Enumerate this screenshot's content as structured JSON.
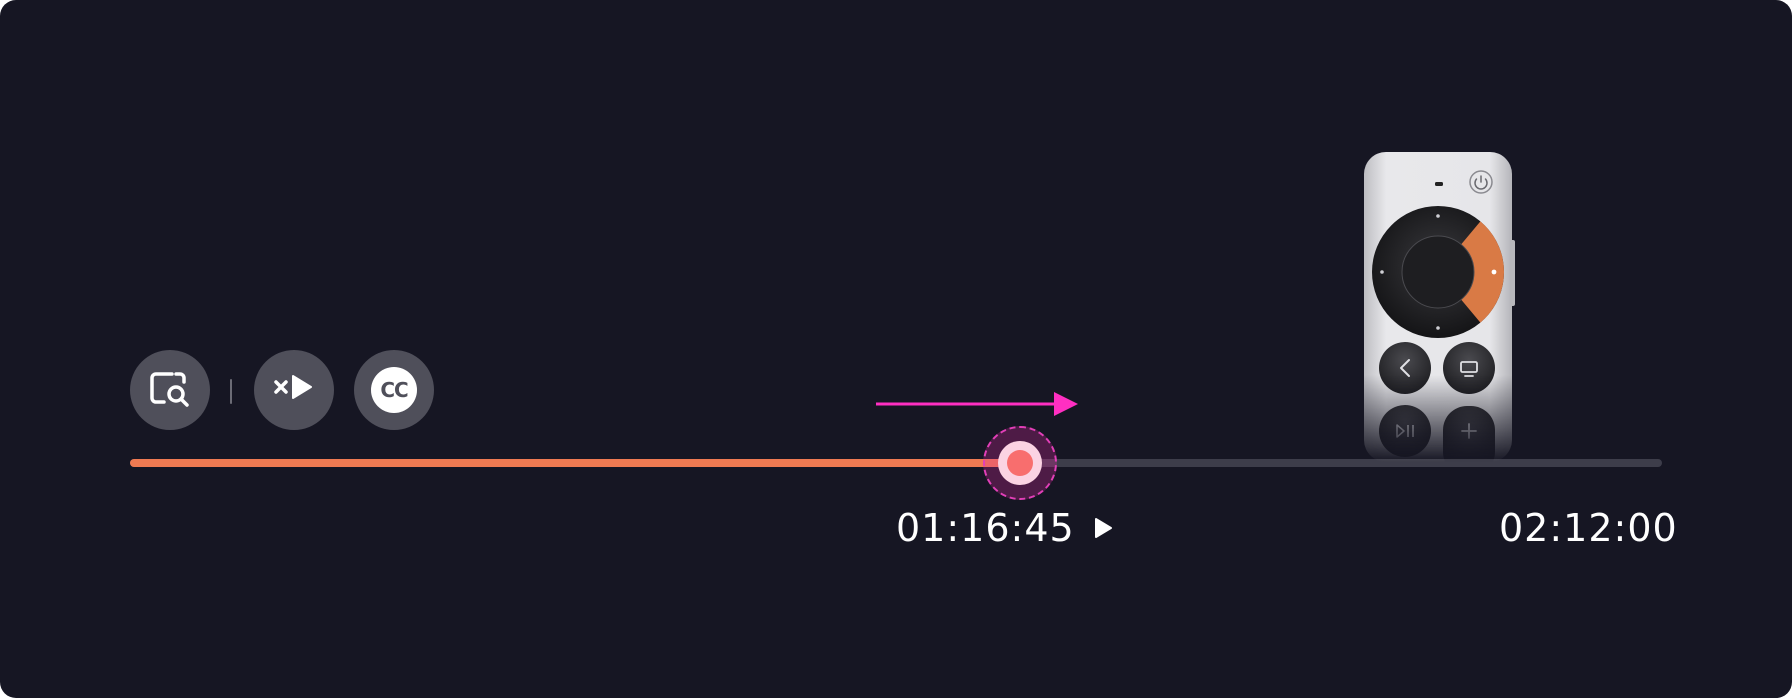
{
  "controls": {
    "search_icon": "screen-search-icon",
    "skip_intro_icon": "skip-play-icon",
    "captions_icon": "closed-captions-icon",
    "captions_label": "CC"
  },
  "scrubber": {
    "current_time": "01:16:45",
    "total_time": "02:12:00",
    "progress": 0.5812,
    "accent_color": "#ef7a52",
    "direction_arrow_color": "#ff2fc2"
  },
  "remote": {
    "icon": "siri-remote-icon",
    "highlighted_control": "clickpad-right"
  }
}
